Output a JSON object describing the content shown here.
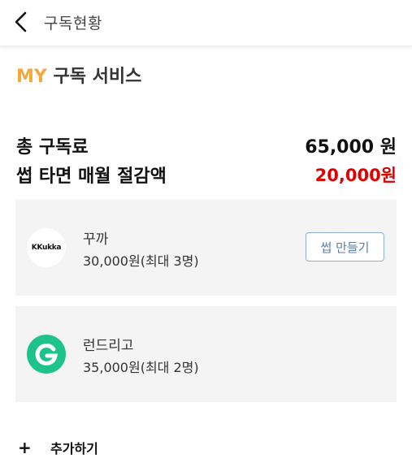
{
  "header": {
    "title": "구독현황",
    "back_icon": "chevron-left-icon"
  },
  "section": {
    "prefix": "MY",
    "title": "구독 서비스",
    "accent_color": "#f2a93b"
  },
  "summary": {
    "total_label": "총 구독료",
    "total_value": "65,000 원",
    "saving_label": "썹 타면 매월 절감액",
    "saving_value": "20,000원",
    "saving_color": "#e00000"
  },
  "subscriptions": [
    {
      "name": "꾸까",
      "price": "30,000원(최대 3명)",
      "logo_text": "KKukka",
      "action_label": "썹 만들기"
    },
    {
      "name": "런드리고",
      "price": "35,000원(최대 2명)",
      "logo_icon": "g-logo-icon",
      "logo_color": "#1ec28b"
    }
  ],
  "add": {
    "icon": "plus-icon",
    "label": "추가하기"
  }
}
